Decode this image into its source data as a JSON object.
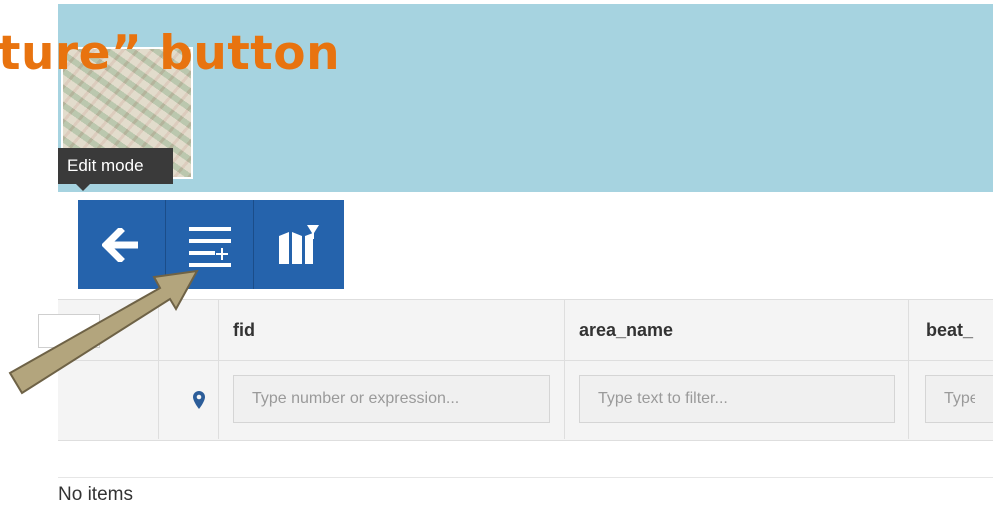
{
  "overlay": {
    "title": "ture” button"
  },
  "tooltip": {
    "text": "Edit mode"
  },
  "toolbar": {
    "back_icon": "arrow-left-icon",
    "add_feature_icon": "list-add-icon",
    "zoom_map_icon": "map-filter-icon"
  },
  "grid": {
    "columns": [
      "fid",
      "area_name",
      "beat_"
    ],
    "filters": {
      "fid_placeholder": "Type number or expression...",
      "area_name_placeholder": "Type text to filter...",
      "beat_placeholder": "Type"
    },
    "location_icon": "map-marker-icon"
  },
  "footer": {
    "empty_text": "No items"
  },
  "colors": {
    "header_band": "#a6d3e0",
    "toolbar": "#2563ac",
    "highlight_text": "#e8730f",
    "arrow": "#b3a57d"
  }
}
